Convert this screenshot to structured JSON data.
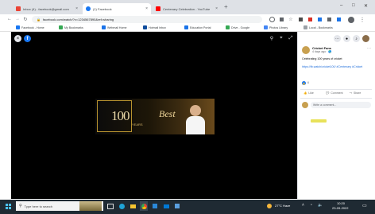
{
  "browser": {
    "tabs": [
      {
        "title": "Inbox (4) - facebook@gmail.com",
        "active": false
      },
      {
        "title": "(1) Facebook",
        "active": true
      },
      {
        "title": "Centenary Celebration - YouTube",
        "active": false
      }
    ],
    "new_tab": "+",
    "window_controls": [
      "–",
      "□",
      "✕"
    ],
    "url": "facebook.com/watch/?v=1234567890&ref=sharing",
    "bookmarks": [
      "Facebook - Home",
      "My Bookmarks",
      "Webmail Home",
      "Hotmail Inbox",
      "Education Portal",
      "Drive - Google",
      "Photos Library",
      "Local - Bookmarks"
    ]
  },
  "video": {
    "banner_text_left": "100",
    "banner_sub": "YEARS",
    "banner_text_right": "Best"
  },
  "post": {
    "page_name": "Cricket Fans",
    "time": "4 days ago · 🌎",
    "caption": "Celebrating 100 years of cricket",
    "link": "https://fb.watch/cricket100/ #Centenary #Cricket",
    "reactions": "6",
    "actions": [
      "Like",
      "Comment",
      "Share"
    ],
    "comment_placeholder": "Write a comment..."
  },
  "taskbar": {
    "search_placeholder": "Type here to search",
    "weather": "27°C Haze",
    "time": "10:20",
    "date": "23-09-2022"
  },
  "colors": {
    "accent": "#1a73e8",
    "video_bg": "#000000",
    "taskbar": "#1f2a33"
  }
}
